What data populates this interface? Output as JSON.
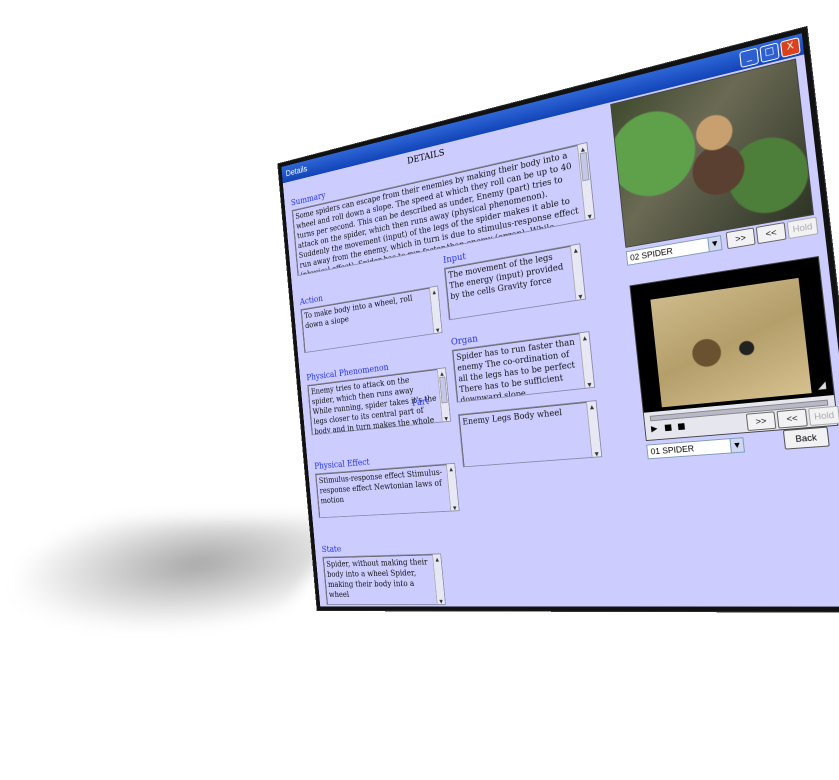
{
  "window": {
    "title": "Details",
    "minimize_label": "_",
    "maximize_label": "□",
    "close_label": "X"
  },
  "heading": "DETAILS",
  "summary": {
    "label": "Summary",
    "text": "Some spiders can escape from their enemies by making their body into a wheel and roll down a slope. The speed at which they roll can be up to 40 turns per second. This can be described as under, Enemy (part) tries to attack on the spider, which then runs away (physical phenomenon). Suddenly the movement (input) of the legs of the spider makes it able to run away from the enemy, which in turn is due to stimulus-response effect (physical effect). Spider has to run faster than enemy (organ). While running, spider takes it's the legs (part) closer to its central part of body and in turn makes the whole body into a wheel (physical phenomenon). The energy (input) provided by the cells"
  },
  "action": {
    "label": "Action",
    "text": "To make body into a wheel, roll down a slope"
  },
  "input": {
    "label": "Input",
    "text": "The movement of the legs The energy (input) provided by the cells Gravity force"
  },
  "physical_phenomenon": {
    "label": "Physical Phenomenon",
    "text": "Enemy tries to attack on the spider, which then runs away While running, spider takes it's the legs closer to its central part of body and in turn makes the whole body into a"
  },
  "organ": {
    "label": "Organ",
    "text": "Spider has to run faster than enemy The co-ordination of all the legs has to be perfect There has to be sufficient downward slope"
  },
  "part": {
    "label": "Part",
    "text": "Enemy Legs Body wheel"
  },
  "physical_effect": {
    "label": "Physical Effect",
    "text": "Stimulus-response effect Stimulus-response effect Newtonian laws of motion"
  },
  "state": {
    "label": "State",
    "text": "Spider, without making their body into a wheel Spider, making their body into a wheel"
  },
  "image_viewer": {
    "selected": "02 SPIDER",
    "next_label": ">>",
    "prev_label": "<<",
    "extra_label": "Hold"
  },
  "video_viewer": {
    "selected": "01 SPIDER",
    "next_label": ">>",
    "prev_label": "<<",
    "extra_label": "Hold",
    "play_label": "▶",
    "pause_label": "■",
    "stop_label": "■"
  },
  "back_label": "Back"
}
